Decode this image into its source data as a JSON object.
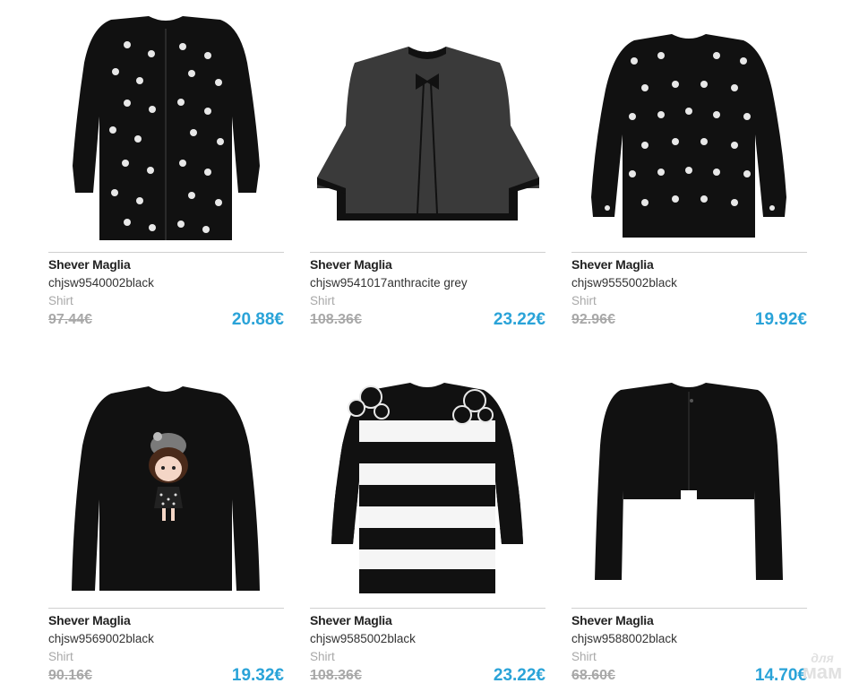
{
  "products": [
    {
      "brand": "Shever Maglia",
      "sku": "chjsw9540002black",
      "category": "Shirt",
      "old_price": "97.44€",
      "price": "20.88€",
      "image_icon": "polka-dot-cardigan"
    },
    {
      "brand": "Shever Maglia",
      "sku": "chjsw9541017anthracite grey",
      "category": "Shirt",
      "old_price": "108.36€",
      "price": "23.22€",
      "image_icon": "grey-bolero"
    },
    {
      "brand": "Shever Maglia",
      "sku": "chjsw9555002black",
      "category": "Shirt",
      "old_price": "92.96€",
      "price": "19.92€",
      "image_icon": "polka-dot-sweater"
    },
    {
      "brand": "Shever Maglia",
      "sku": "chjsw9569002black",
      "category": "Shirt",
      "old_price": "90.16€",
      "price": "19.32€",
      "image_icon": "girl-print-sweater"
    },
    {
      "brand": "Shever Maglia",
      "sku": "chjsw9585002black",
      "category": "Shirt",
      "old_price": "108.36€",
      "price": "23.22€",
      "image_icon": "striped-sweater"
    },
    {
      "brand": "Shever Maglia",
      "sku": "chjsw9588002black",
      "category": "Shirt",
      "old_price": "68.60€",
      "price": "14.70€",
      "image_icon": "black-bolero"
    }
  ],
  "colors": {
    "price": "#2aa3d8",
    "old_price": "#a8a8a8",
    "garment": "#111111"
  },
  "watermark": {
    "line1": "для",
    "line2": "мам"
  }
}
